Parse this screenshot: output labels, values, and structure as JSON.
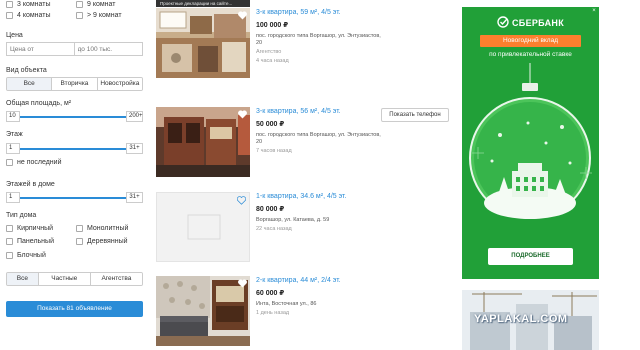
{
  "filters": {
    "rooms": [
      "3 комнаты",
      "9 комнат",
      "4 комнаты",
      "> 9 комнат"
    ],
    "price_label": "Цена",
    "price_from_placeholder": "Цена от",
    "price_to_placeholder": "до 100 тыс.",
    "object_type_label": "Вид объекта",
    "object_type_tabs": [
      "Все",
      "Вторичка",
      "Новостройка"
    ],
    "area_label": "Общая площадь, м²",
    "area_min": "10",
    "area_max": "200+",
    "floor_label": "Этаж",
    "floor_min": "1",
    "floor_max": "31+",
    "not_last": "не последний",
    "floors_label": "Этажей в доме",
    "floors_min": "1",
    "floors_max": "31+",
    "house_type_label": "Тип дома",
    "house_types": [
      "Кирпичный",
      "Монолитный",
      "Панельный",
      "Деревянный",
      "Блочный"
    ],
    "seller_tabs": [
      "Все",
      "Частные",
      "Агентства"
    ],
    "submit": "Показать 81 объявление"
  },
  "top_banner": "Проектные декларации на сайте...",
  "listings": [
    {
      "title": "3-к квартира, 59 м², 4/5 эт.",
      "price": "100 000 ₽",
      "address": "пос. городского типа Воргашор, ул. Энтузиастов, 20",
      "agency": "Агентство",
      "time": "4 часа назад"
    },
    {
      "title": "3-к квартира, 56 м², 4/5 эт.",
      "price": "50 000 ₽",
      "address": "пос. городского типа Воргашор, ул. Энтузиастов, 20",
      "time": "7 часов назад"
    },
    {
      "title": "1-к квартира, 34.6 м², 4/5 эт.",
      "price": "80 000 ₽",
      "address": "Воргашор, ул. Катаева, д. 59",
      "time": "22 часа назад"
    },
    {
      "title": "2-к квартира, 44 м², 2/4 эт.",
      "price": "60 000 ₽",
      "address": "Инта, Восточная ул., 86",
      "time": "1 день назад"
    }
  ],
  "phone_button": "Показать телефон",
  "ad": {
    "brand": "СБЕРБАНК",
    "tag": "Новогодний вклад",
    "subtitle": "по привлекательной ставке",
    "cta": "ПОДРОБНЕЕ",
    "close": "×"
  },
  "watermark": "YAPLAKAL.COM",
  "colors": {
    "accent": "#2a8cd7",
    "sber_green": "#21a038",
    "sber_orange": "#ff7f2e"
  }
}
